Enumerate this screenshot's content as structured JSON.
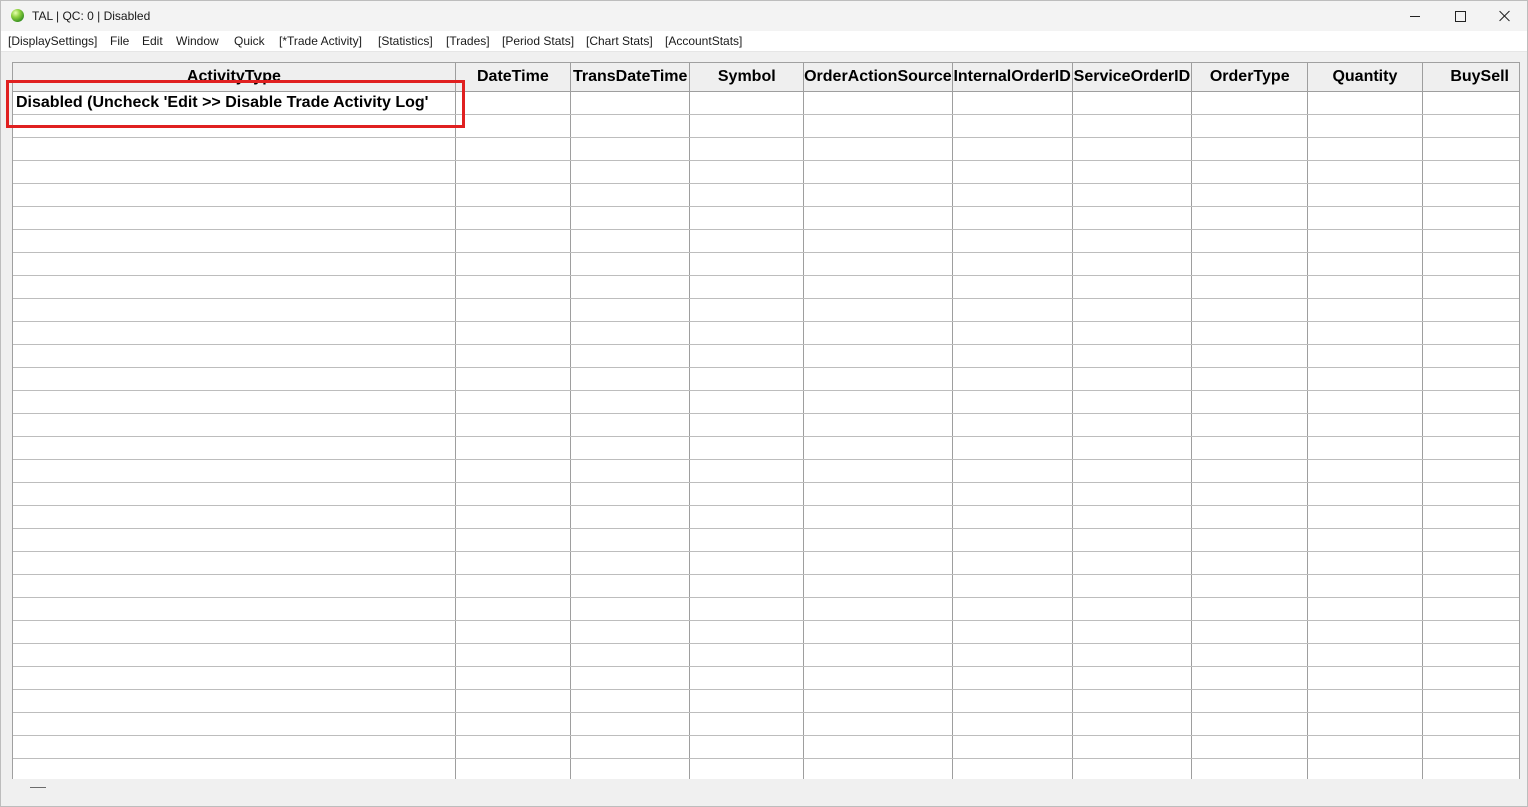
{
  "window": {
    "title": "TAL | QC: 0 | Disabled"
  },
  "menu": {
    "items": [
      {
        "label": "[DisplaySettings]"
      },
      {
        "label": "File"
      },
      {
        "label": "Edit"
      },
      {
        "label": "Window"
      },
      {
        "label": "Quick"
      },
      {
        "label": "[*Trade Activity]"
      },
      {
        "label": "[Statistics]"
      },
      {
        "label": "[Trades]"
      },
      {
        "label": "[Period Stats]"
      },
      {
        "label": "[Chart Stats]"
      },
      {
        "label": "[AccountStats]"
      }
    ]
  },
  "grid": {
    "columns": [
      "ActivityType",
      "DateTime",
      "TransDateTime",
      "Symbol",
      "OrderActionSource",
      "InternalOrderID",
      "ServiceOrderID",
      "OrderType",
      "Quantity",
      "BuySell"
    ],
    "first_row_message": "Disabled (Uncheck 'Edit >> Disable Trade Activity Log'",
    "empty_row_count": 29
  },
  "annotation": {
    "highlight_color": "#e02020"
  }
}
